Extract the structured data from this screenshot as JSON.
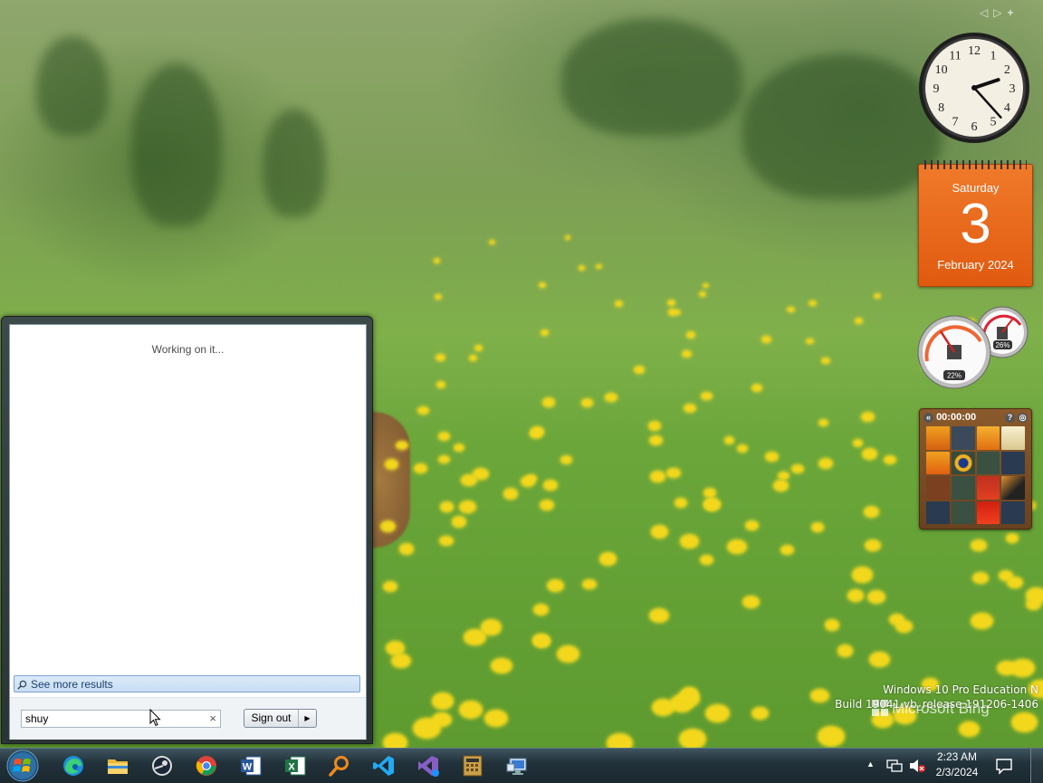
{
  "desktop": {
    "watermark": {
      "bing_label": "Microsoft Bing",
      "edition": "Windows 10 Pro Education N",
      "build": "Build 19041.vb_release.191206-1406"
    }
  },
  "gadget_nav": {
    "prev": "◁",
    "next": "▷",
    "add": "+"
  },
  "clock_gadget": {
    "hour": 2,
    "minute": 23
  },
  "calendar_gadget": {
    "weekday": "Saturday",
    "day": "3",
    "month_year": "February 2024"
  },
  "cpu_meter": {
    "cpu_percent": "22%",
    "memory_percent": "26%",
    "cpu": 22,
    "memory": 26
  },
  "puzzle_gadget": {
    "timer": "00:00:00",
    "help": "?"
  },
  "start_menu": {
    "status_text": "Working on it...",
    "see_more_results": "See more results",
    "search": {
      "value": "shuy",
      "clear": "×"
    },
    "sign_out": "Sign out",
    "sign_out_arrow": "▶"
  },
  "taskbar": {
    "pinned": [
      "Microsoft Edge",
      "File Explorer",
      "Steam",
      "Google Chrome",
      "Microsoft Word",
      "Microsoft Excel",
      "Search Everything",
      "Visual Studio Code",
      "Visual Studio",
      "Calculator",
      "Remote Desktop"
    ],
    "tray_chevron": "▲",
    "time": "2:23 AM",
    "date": "2/3/2024"
  }
}
